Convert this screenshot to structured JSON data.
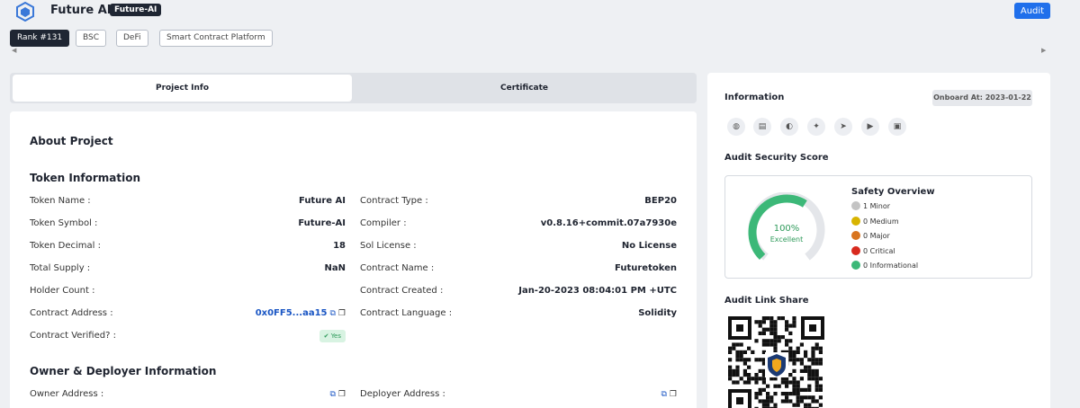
{
  "header": {
    "project_name": "Future AI",
    "project_symbol": "Future-AI",
    "audit_button": "Audit"
  },
  "tags": [
    "Rank #131",
    "BSC",
    "DeFi",
    "Smart Contract Platform"
  ],
  "tabs": [
    {
      "label": "Project Info",
      "active": true
    },
    {
      "label": "Certificate",
      "active": false
    }
  ],
  "about": {
    "title": "About Project",
    "token_section_title": "Token Information",
    "owner_section_title": "Owner & Deployer Information"
  },
  "token_left": [
    {
      "label": "Token Name :",
      "value": "Future AI"
    },
    {
      "label": "Token Symbol :",
      "value": "Future-AI"
    },
    {
      "label": "Token Decimal :",
      "value": "18"
    },
    {
      "label": "Total Supply :",
      "value": "NaN"
    },
    {
      "label": "Holder Count :",
      "value": ""
    },
    {
      "label": "Contract Address :",
      "value": "0x0FF5...aa15"
    },
    {
      "label": "Contract Verified? :",
      "value": "Yes"
    }
  ],
  "token_right": [
    {
      "label": "Contract Type :",
      "value": "BEP20"
    },
    {
      "label": "Compiler :",
      "value": "v0.8.16+commit.07a7930e"
    },
    {
      "label": "Sol License :",
      "value": "No License"
    },
    {
      "label": "Contract Name :",
      "value": "Futuretoken"
    },
    {
      "label": "Contract Created :",
      "value": "Jan-20-2023 08:04:01 PM +UTC"
    },
    {
      "label": "Contract Language :",
      "value": "Solidity"
    }
  ],
  "owner": {
    "owner_label": "Owner Address :",
    "deployer_label": "Deployer Address :"
  },
  "information": {
    "title": "Information",
    "onboard": "Onboard At: 2023-01-22",
    "social_icons": [
      "globe-icon",
      "document-icon",
      "github-icon",
      "twitter-icon",
      "telegram-icon",
      "youtube-icon",
      "medium-icon"
    ]
  },
  "score": {
    "title": "Audit Security Score",
    "percent_text": "100%",
    "percent": 100,
    "rating": "Excellent",
    "overview_title": "Safety Overview",
    "items": [
      {
        "label": "1 Minor",
        "color": "#c4c4c4"
      },
      {
        "label": "0 Medium",
        "color": "#d8b400"
      },
      {
        "label": "0 Major",
        "color": "#d8741e"
      },
      {
        "label": "0 Critical",
        "color": "#d82a1e"
      },
      {
        "label": "0 Informational",
        "color": "#3cb878"
      }
    ],
    "gauge_color": "#3cb878"
  },
  "link_share": {
    "title": "Audit Link Share"
  }
}
